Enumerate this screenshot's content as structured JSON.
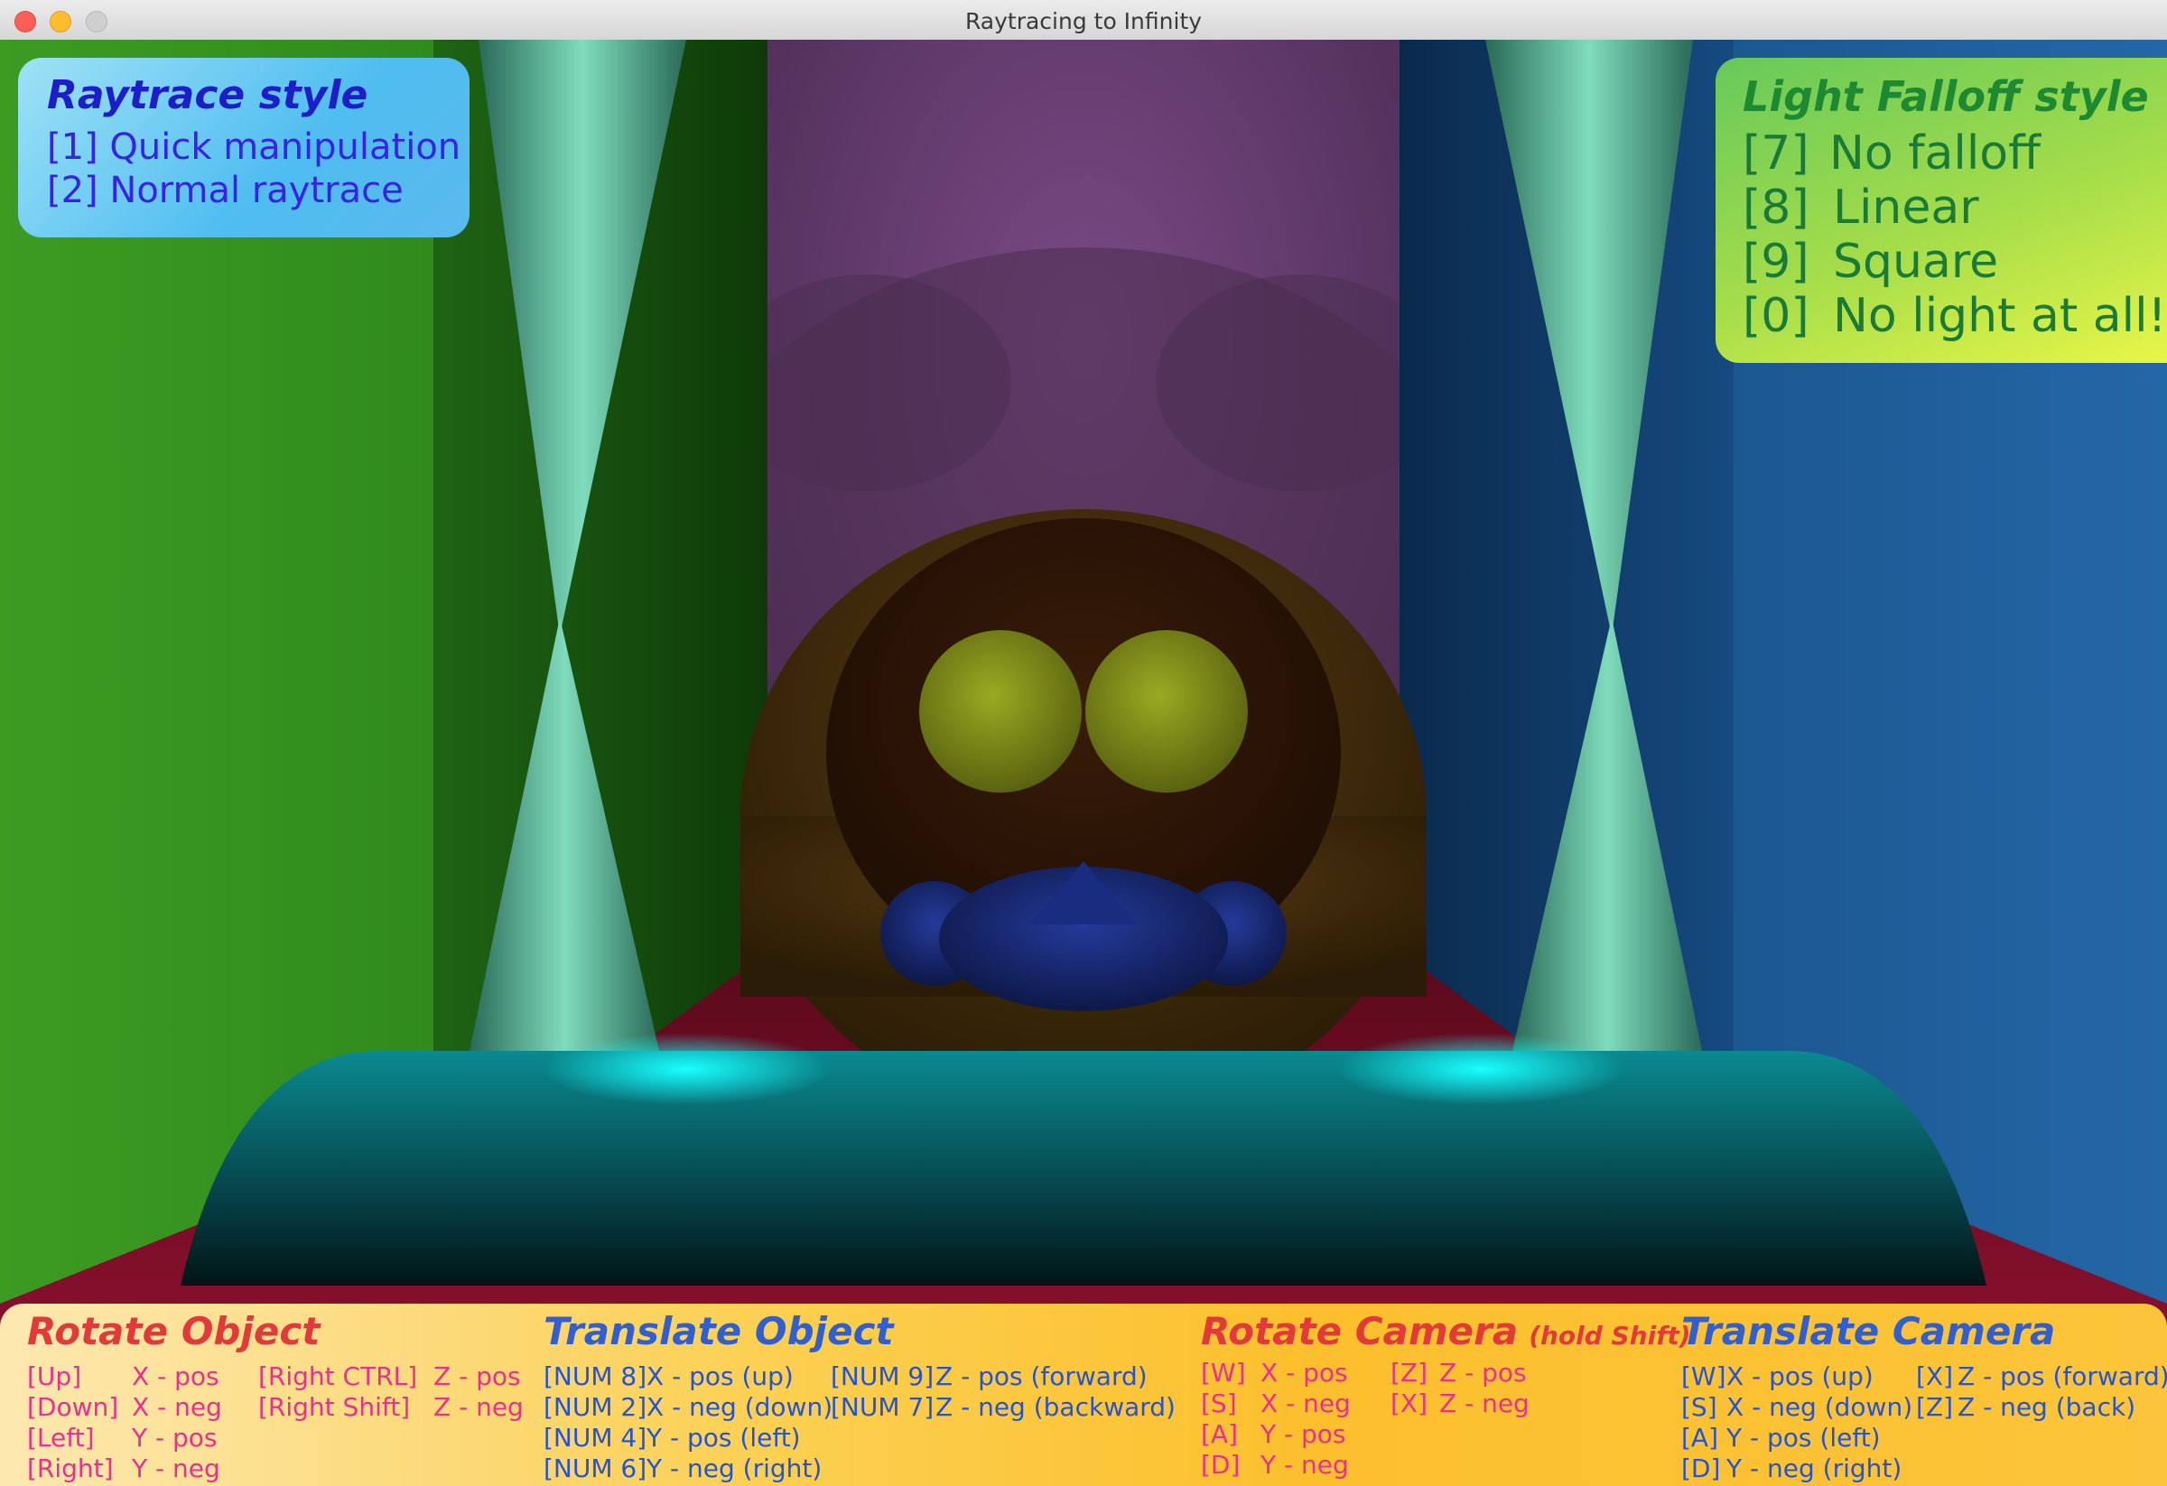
{
  "window": {
    "title": "Raytracing to Infinity"
  },
  "raytrace_style": {
    "title": "Raytrace style",
    "options": [
      {
        "key": "[1]",
        "label": "Quick manipulation"
      },
      {
        "key": "[2]",
        "label": "Normal raytrace"
      }
    ]
  },
  "light_falloff": {
    "title": "Light Falloff style",
    "options": [
      {
        "key": "[7]",
        "label": "No falloff"
      },
      {
        "key": "[8]",
        "label": "Linear"
      },
      {
        "key": "[9]",
        "label": "Square"
      },
      {
        "key": "[0]",
        "label": "No light at all!"
      }
    ]
  },
  "rotate_object": {
    "title": "Rotate Object",
    "col1": [
      {
        "key": "[Up]",
        "label": "X - pos"
      },
      {
        "key": "[Down]",
        "label": "X - neg"
      },
      {
        "key": "[Left]",
        "label": "Y - pos"
      },
      {
        "key": "[Right]",
        "label": "Y - neg"
      }
    ],
    "col2": [
      {
        "key": "[Right CTRL]",
        "label": "Z - pos"
      },
      {
        "key": "[Right Shift]",
        "label": "Z - neg"
      }
    ]
  },
  "translate_object": {
    "title": "Translate Object",
    "col1": [
      {
        "key": "[NUM 8]",
        "label": "X - pos (up)"
      },
      {
        "key": "[NUM 2]",
        "label": "X - neg (down)"
      },
      {
        "key": "[NUM 4]",
        "label": "Y - pos (left)"
      },
      {
        "key": "[NUM 6]",
        "label": "Y - neg (right)"
      }
    ],
    "col2": [
      {
        "key": "[NUM 9]",
        "label": "Z - pos (forward)"
      },
      {
        "key": "[NUM 7]",
        "label": "Z - neg (backward)"
      }
    ]
  },
  "rotate_camera": {
    "title": "Rotate Camera",
    "note": "(hold Shift)",
    "col1": [
      {
        "key": "[W]",
        "label": "X - pos"
      },
      {
        "key": "[S]",
        "label": "X - neg"
      },
      {
        "key": "[A]",
        "label": "Y - pos"
      },
      {
        "key": "[D]",
        "label": "Y - neg"
      }
    ],
    "col2": [
      {
        "key": "[Z]",
        "label": "Z - pos"
      },
      {
        "key": "[X]",
        "label": "Z - neg"
      }
    ]
  },
  "translate_camera": {
    "title": "Translate Camera",
    "col1": [
      {
        "key": "[W]",
        "label": "X - pos (up)"
      },
      {
        "key": "[S]",
        "label": "X - neg (down)"
      },
      {
        "key": "[A]",
        "label": "Y - pos (left)"
      },
      {
        "key": "[D]",
        "label": "Y - neg (right)"
      }
    ],
    "col2": [
      {
        "key": "[X]",
        "label": "Z - pos (forward)"
      },
      {
        "key": "[Z]",
        "label": "Z - neg (back)"
      }
    ]
  },
  "scene_colors": {
    "left_wall": "#3a9a26",
    "right_wall": "#1f5f9c",
    "back_wall": "#6e4478",
    "floor": "#8a0f2c",
    "cones": "#6cd2b2",
    "cushion": "#0aa0a6",
    "owl_body": "#4a3410",
    "owl_eyes": "#8a9a1e",
    "owl_beak": "#1c2c78"
  }
}
